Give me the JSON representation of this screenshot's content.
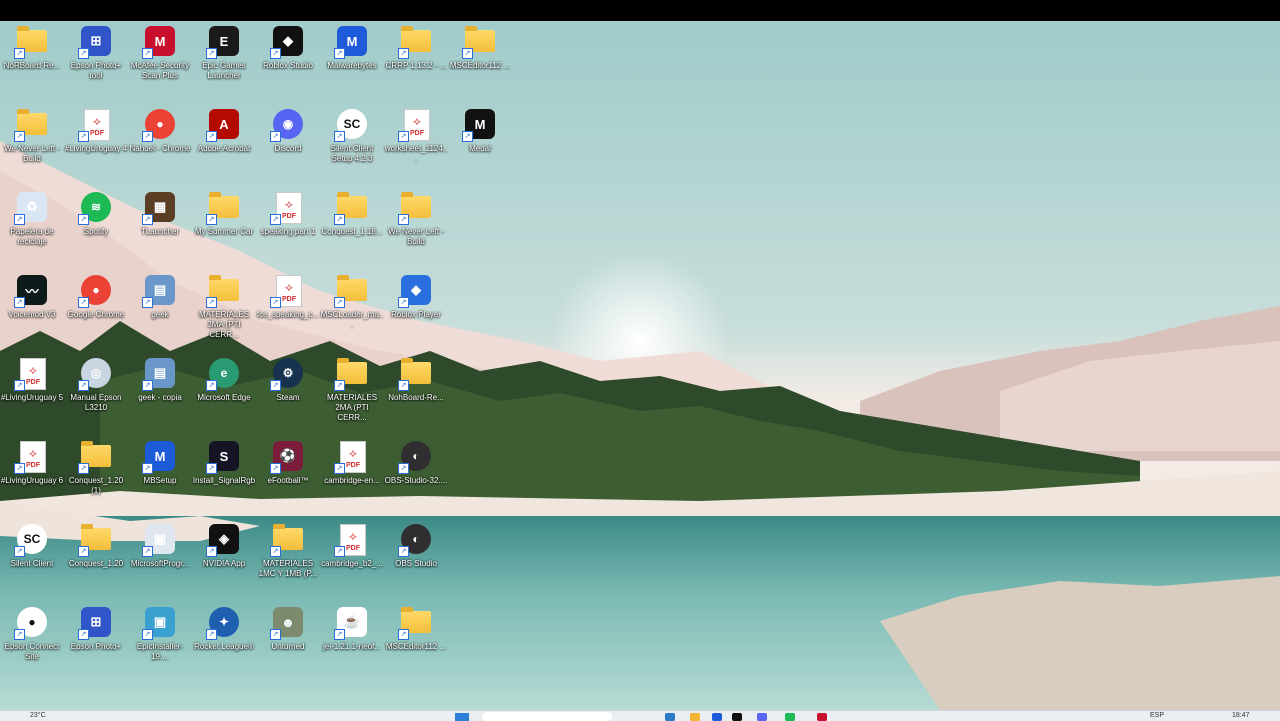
{
  "desktop": {
    "icons": [
      {
        "label": "NoRBoard Re...",
        "icon": "folder-icon",
        "kind": "folder"
      },
      {
        "label": "Epson Photo+ tool",
        "icon": "epson-photo-icon",
        "kind": "tile",
        "color": "#2f55c9",
        "glyph": "⊞"
      },
      {
        "label": "McAfee Security Scan Plus",
        "icon": "mcafee-icon",
        "kind": "tile",
        "color": "#c8102e",
        "glyph": "M"
      },
      {
        "label": "Epic Games Launcher",
        "icon": "epic-games-icon",
        "kind": "tile",
        "color": "#1a1a1a",
        "glyph": "E"
      },
      {
        "label": "Roblox Studio",
        "icon": "roblox-studio-icon",
        "kind": "tile",
        "color": "#111111",
        "glyph": "◆"
      },
      {
        "label": "Malwarebytes",
        "icon": "malwarebytes-icon",
        "kind": "tile",
        "color": "#1e5bd8",
        "glyph": "M"
      },
      {
        "label": "CRRP 1.13.2 - ...",
        "icon": "folder-icon",
        "kind": "folder"
      },
      {
        "label": "MSCEditor112 ...",
        "icon": "folder-icon",
        "kind": "folder"
      },
      {
        "label": "We Never Left - Build",
        "icon": "folder-icon",
        "kind": "folder"
      },
      {
        "label": "#LivingUruguay 4",
        "icon": "pdf-icon",
        "kind": "pdf"
      },
      {
        "label": "Nahuel - Chrome",
        "icon": "chrome-icon",
        "kind": "circle",
        "color": "#ea4335",
        "glyph": "●"
      },
      {
        "label": "Adobe Acrobat",
        "icon": "adobe-acrobat-icon",
        "kind": "tile",
        "color": "#b30b00",
        "glyph": "A"
      },
      {
        "label": "Discord",
        "icon": "discord-icon",
        "kind": "circle",
        "color": "#5865f2",
        "glyph": "◉"
      },
      {
        "label": "Silent Client Setup 4.2.3",
        "icon": "silent-client-icon",
        "kind": "circle",
        "color": "#ffffff",
        "glyph": "SC"
      },
      {
        "label": "worksheet_1124...",
        "icon": "pdf-icon",
        "kind": "pdf"
      },
      {
        "label": "Medal",
        "icon": "medal-icon",
        "kind": "tile",
        "color": "#111111",
        "glyph": "M"
      },
      {
        "label": "Papelera de reciclaje",
        "icon": "recycle-bin-icon",
        "kind": "tile",
        "color": "#d9e7f5",
        "glyph": "♻"
      },
      {
        "label": "Spotify",
        "icon": "spotify-icon",
        "kind": "circle",
        "color": "#1db954",
        "glyph": "≋"
      },
      {
        "label": "TLauncher",
        "icon": "tlauncher-icon",
        "kind": "tile",
        "color": "#5a3d22",
        "glyph": "▦"
      },
      {
        "label": "My Summer Car",
        "icon": "folder-icon",
        "kind": "folder"
      },
      {
        "label": "speaking part 1",
        "icon": "pdf-icon",
        "kind": "pdf"
      },
      {
        "label": "Conquest_1.18...",
        "icon": "folder-icon",
        "kind": "folder"
      },
      {
        "label": "We Never Left - Build",
        "icon": "folder-icon",
        "kind": "folder"
      },
      {
        "label": "",
        "icon": "",
        "kind": "none"
      },
      {
        "label": "Voicemod V3",
        "icon": "voicemod-icon",
        "kind": "tile",
        "color": "#0f1a1a",
        "glyph": "〰"
      },
      {
        "label": "Google Chrome",
        "icon": "chrome-icon",
        "kind": "circle",
        "color": "#ea4335",
        "glyph": "●"
      },
      {
        "label": "geek",
        "icon": "geek-icon",
        "kind": "tile",
        "color": "#6a97c9",
        "glyph": "▤"
      },
      {
        "label": "MATERIALES 3MA (PTI CERR...",
        "icon": "folder-icon",
        "kind": "folder"
      },
      {
        "label": "fce_speaking_c...",
        "icon": "pdf-icon",
        "kind": "pdf"
      },
      {
        "label": "MSCLoader_ma...",
        "icon": "folder-icon",
        "kind": "folder"
      },
      {
        "label": "Roblox Player",
        "icon": "roblox-player-icon",
        "kind": "tile",
        "color": "#2a6fe0",
        "glyph": "◆"
      },
      {
        "label": "",
        "icon": "",
        "kind": "none"
      },
      {
        "label": "#LivingUruguay 5",
        "icon": "pdf-icon",
        "kind": "pdf"
      },
      {
        "label": "Manual Epson L3210",
        "icon": "manual-icon",
        "kind": "circle",
        "color": "#c9d6e2",
        "glyph": "◎"
      },
      {
        "label": "geek - copia",
        "icon": "geek-icon",
        "kind": "tile",
        "color": "#6a97c9",
        "glyph": "▤"
      },
      {
        "label": "Microsoft Edge",
        "icon": "edge-icon",
        "kind": "circle",
        "color": "#2a9a72",
        "glyph": "e"
      },
      {
        "label": "Steam",
        "icon": "steam-icon",
        "kind": "circle",
        "color": "#17324f",
        "glyph": "⚙"
      },
      {
        "label": "MATERIALES 2MA (PTI CERR...",
        "icon": "folder-icon",
        "kind": "folder"
      },
      {
        "label": "NohBoard-Re...",
        "icon": "folder-icon",
        "kind": "folder"
      },
      {
        "label": "",
        "icon": "",
        "kind": "none"
      },
      {
        "label": "#LivingUruguay 6",
        "icon": "pdf-icon",
        "kind": "pdf"
      },
      {
        "label": "Conquest_1.20 (1)",
        "icon": "folder-icon",
        "kind": "folder"
      },
      {
        "label": "MBSetup",
        "icon": "mbsetup-icon",
        "kind": "tile",
        "color": "#1e5bd8",
        "glyph": "M"
      },
      {
        "label": "Install_SignalRgb",
        "icon": "signalrgb-icon",
        "kind": "tile",
        "color": "#151525",
        "glyph": "S"
      },
      {
        "label": "eFootball™",
        "icon": "efootball-icon",
        "kind": "tile",
        "color": "#7a1d3a",
        "glyph": "⚽"
      },
      {
        "label": "cambridge-en...",
        "icon": "pdf-icon",
        "kind": "pdf"
      },
      {
        "label": "OBS-Studio-32....",
        "icon": "obs-icon",
        "kind": "circle",
        "color": "#302e31",
        "glyph": "◐"
      },
      {
        "label": "",
        "icon": "",
        "kind": "none"
      },
      {
        "label": "Silent Client",
        "icon": "silent-client-icon",
        "kind": "circle",
        "color": "#ffffff",
        "glyph": "SC"
      },
      {
        "label": "Conquest_1.20",
        "icon": "folder-icon",
        "kind": "folder"
      },
      {
        "label": "MicrosoftProgr...",
        "icon": "installer-icon",
        "kind": "tile",
        "color": "#dfe6ee",
        "glyph": "▣"
      },
      {
        "label": "NVIDIA App",
        "icon": "nvidia-icon",
        "kind": "tile",
        "color": "#111111",
        "glyph": "◈"
      },
      {
        "label": "MATERIALES 1MC Y 1MB (P...",
        "icon": "folder-icon",
        "kind": "folder"
      },
      {
        "label": "cambridge_b2_...",
        "icon": "pdf-icon",
        "kind": "pdf"
      },
      {
        "label": "OBS Studio",
        "icon": "obs-icon",
        "kind": "circle",
        "color": "#302e31",
        "glyph": "◐"
      },
      {
        "label": "",
        "icon": "",
        "kind": "none"
      },
      {
        "label": "Epson Connect Site",
        "icon": "chrome-doc-icon",
        "kind": "circle",
        "color": "#ffffff",
        "glyph": "●"
      },
      {
        "label": "Epson Photo+",
        "icon": "epson-photo-icon",
        "kind": "tile",
        "color": "#2f55c9",
        "glyph": "⊞"
      },
      {
        "label": "EpicInstaller-19....",
        "icon": "installer-icon",
        "kind": "tile",
        "color": "#3aa0d0",
        "glyph": "▣"
      },
      {
        "label": "Rocket League®",
        "icon": "rocket-league-icon",
        "kind": "circle",
        "color": "#1f5fb0",
        "glyph": "✦"
      },
      {
        "label": "Unturned",
        "icon": "unturned-icon",
        "kind": "tile",
        "color": "#7c8a6d",
        "glyph": "☻"
      },
      {
        "label": "jei-1.21.1-neof...",
        "icon": "java-icon",
        "kind": "tile",
        "color": "#ffffff",
        "glyph": "☕"
      },
      {
        "label": "MSCEditor112 ...",
        "icon": "folder-icon",
        "kind": "folder"
      },
      {
        "label": "",
        "icon": "",
        "kind": "none"
      }
    ]
  },
  "taskbar": {
    "weather": "23°C",
    "language": "ESP",
    "clock": "18:47"
  }
}
